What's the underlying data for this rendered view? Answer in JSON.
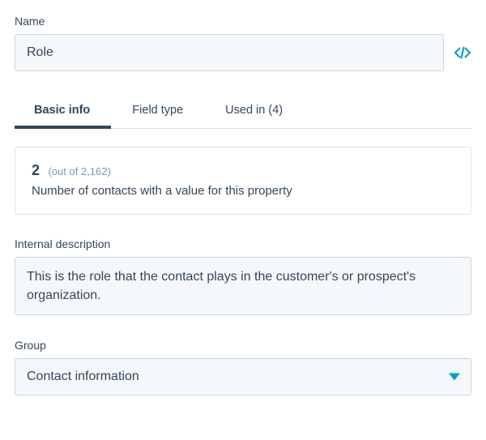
{
  "name": {
    "label": "Name",
    "value": "Role"
  },
  "tabs": [
    {
      "label": "Basic info",
      "active": true
    },
    {
      "label": "Field type",
      "active": false
    },
    {
      "label": "Used in (4)",
      "active": false
    }
  ],
  "stat": {
    "count": "2",
    "total_text": "(out of 2,162)",
    "description": "Number of contacts with a value for this property"
  },
  "internal_description": {
    "label": "Internal description",
    "value": "This is the role that the contact plays in the customer's or prospect's organization."
  },
  "group": {
    "label": "Group",
    "value": "Contact information"
  },
  "colors": {
    "accent": "#00a4bd"
  }
}
